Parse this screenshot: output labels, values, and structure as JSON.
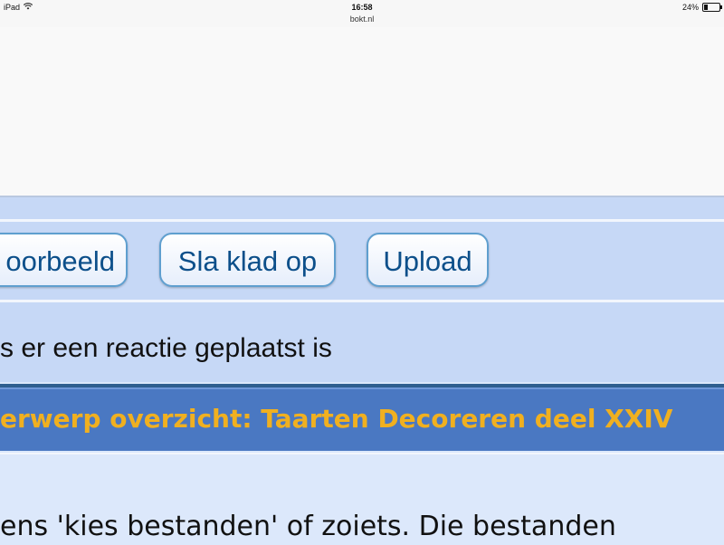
{
  "status_bar": {
    "device": "iPad",
    "time": "16:58",
    "url": "bokt.nl",
    "battery": "24%",
    "battery_level": 0.24
  },
  "buttons": {
    "preview": "oorbeeld",
    "save_draft": "Sla klad op",
    "upload": "Upload"
  },
  "notify_text": "s er een reactie geplaatst is",
  "topic_title": "erwerp overzicht: Taarten Decoreren deel XXIV",
  "content_text": "ens 'kies bestanden' of zoiets. Die bestanden"
}
